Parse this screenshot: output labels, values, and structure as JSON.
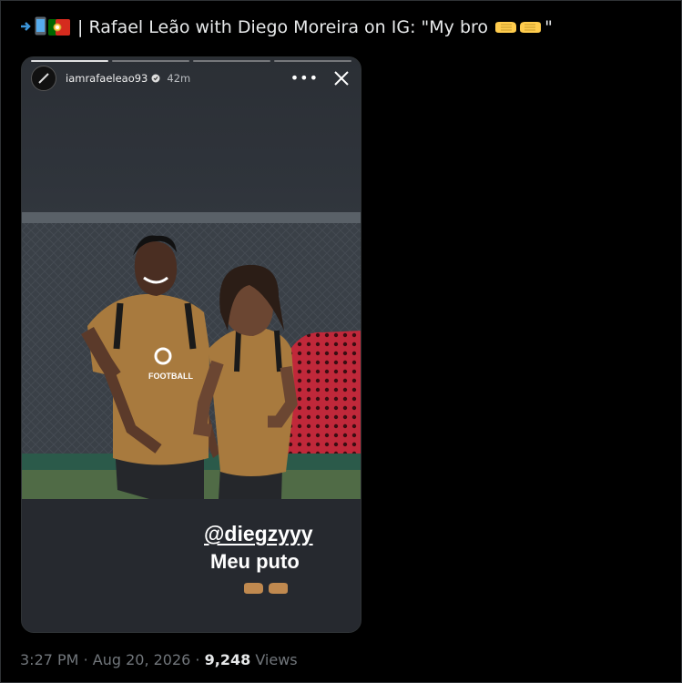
{
  "tweet": {
    "text": "| Rafael Leão with Diego Moreira on IG: \"My bro",
    "closing_quote": "\"",
    "emojis": [
      "arrow-in-icon",
      "phone-icon",
      "portugal-flag-icon",
      "fist-bump-emoji"
    ]
  },
  "story": {
    "username": "iamrafaeleao93",
    "time": "42m",
    "mention": "@diegzyyy",
    "caption": "Meu puto",
    "kit_sponsor": "FOOTBALL"
  },
  "meta": {
    "time": "3:27 PM",
    "dot1": "·",
    "date": "Aug 20, 2026",
    "dot2": "·",
    "views_count": "9,248",
    "views_label": "Views"
  },
  "colors": {
    "background": "#000000",
    "text": "#e7e9ea",
    "muted": "#71767b",
    "story_bg": "#26292f",
    "kit": "#a87a3e"
  }
}
